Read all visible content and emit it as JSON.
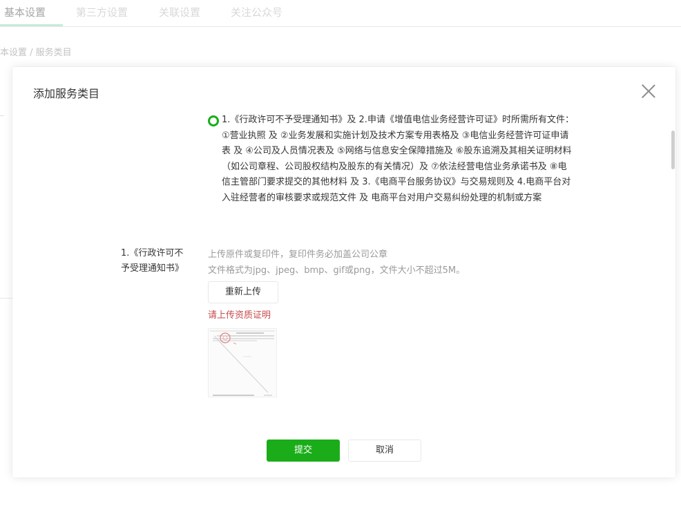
{
  "background": {
    "tabs": [
      {
        "label": "基本设置",
        "active": true
      },
      {
        "label": "第三方设置",
        "active": false
      },
      {
        "label": "关联设置",
        "active": false
      },
      {
        "label": "关注公众号",
        "active": false
      }
    ],
    "breadcrumb": "本设置 / 服务类目"
  },
  "modal": {
    "title": "添加服务类目",
    "option": {
      "selected": true,
      "text": "1.《行政许可不予受理通知书》及 2.申请《增值电信业务经营许可证》时所需所有文件： ①营业执照 及 ②业务发展和实施计划及技术方案专用表格及 ③电信业务经营许可证申请表 及 ④公司及人员情况表及 ⑤网络与信息安全保障措施及 ⑥股东追溯及其相关证明材料（如公司章程、公司股权结构及股东的有关情况）及 ⑦依法经营电信业务承诺书及 ⑧电信主管部门要求提交的其他材料 及 3.《电商平台服务协议》与交易规则及 4.电商平台对入驻经营者的审核要求或规范文件 及 电商平台对用户交易纠纷处理的机制或方案"
    },
    "upload": {
      "label": "1.《行政许可不予受理通知书》",
      "hint1": "上传原件或复印件，复印件务必加盖公司公章",
      "hint2": "文件格式为jpg、jpeg、bmp、gif或png，文件大小不超过5M。",
      "reupload_label": "重新上传",
      "error": "请上传资质证明"
    },
    "buttons": {
      "submit": "提交",
      "cancel": "取消"
    },
    "colors": {
      "primary": "#1aad19",
      "error": "#c74a4a"
    }
  }
}
